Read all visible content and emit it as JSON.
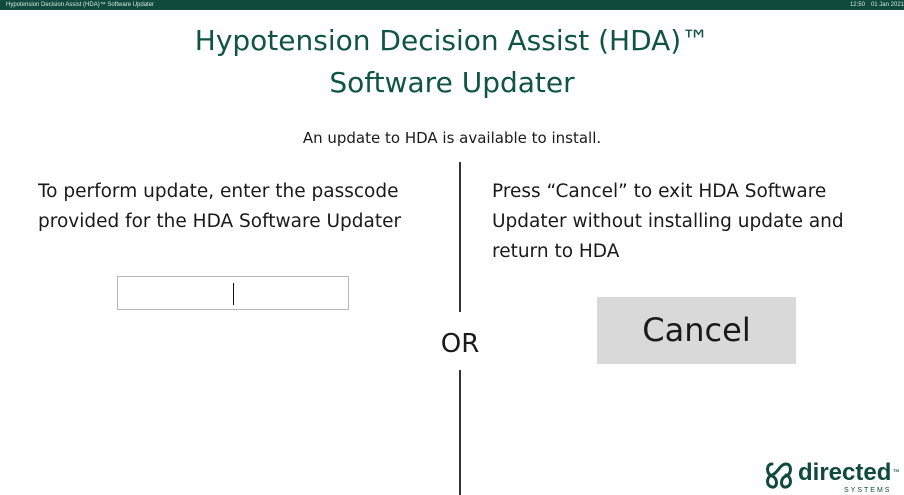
{
  "window": {
    "title": "Hypotension Decision Assist (HDA)™ Software Updater",
    "time": "12:50",
    "date": "01 Jan 2021"
  },
  "header": {
    "title_line1": "Hypotension Decision Assist (HDA)™",
    "title_line2": "Software Updater",
    "subtitle": "An update to HDA is available to install."
  },
  "left_panel": {
    "instructions": "To perform update, enter the passcode provided for the HDA Software Updater",
    "passcode_value": ""
  },
  "separator": {
    "label": "OR"
  },
  "right_panel": {
    "instructions": "Press “Cancel” to exit HDA Software Updater without installing update and return to HDA",
    "cancel_label": "Cancel"
  },
  "logo": {
    "wordmark": "directed",
    "trademark": "™",
    "subtext": "SYSTEMS",
    "icon": "interlocking-loops-icon"
  },
  "colors": {
    "titlebar": "#0f4a3c",
    "title_text": "#0f5445",
    "button_bg": "#d9d9d9"
  }
}
